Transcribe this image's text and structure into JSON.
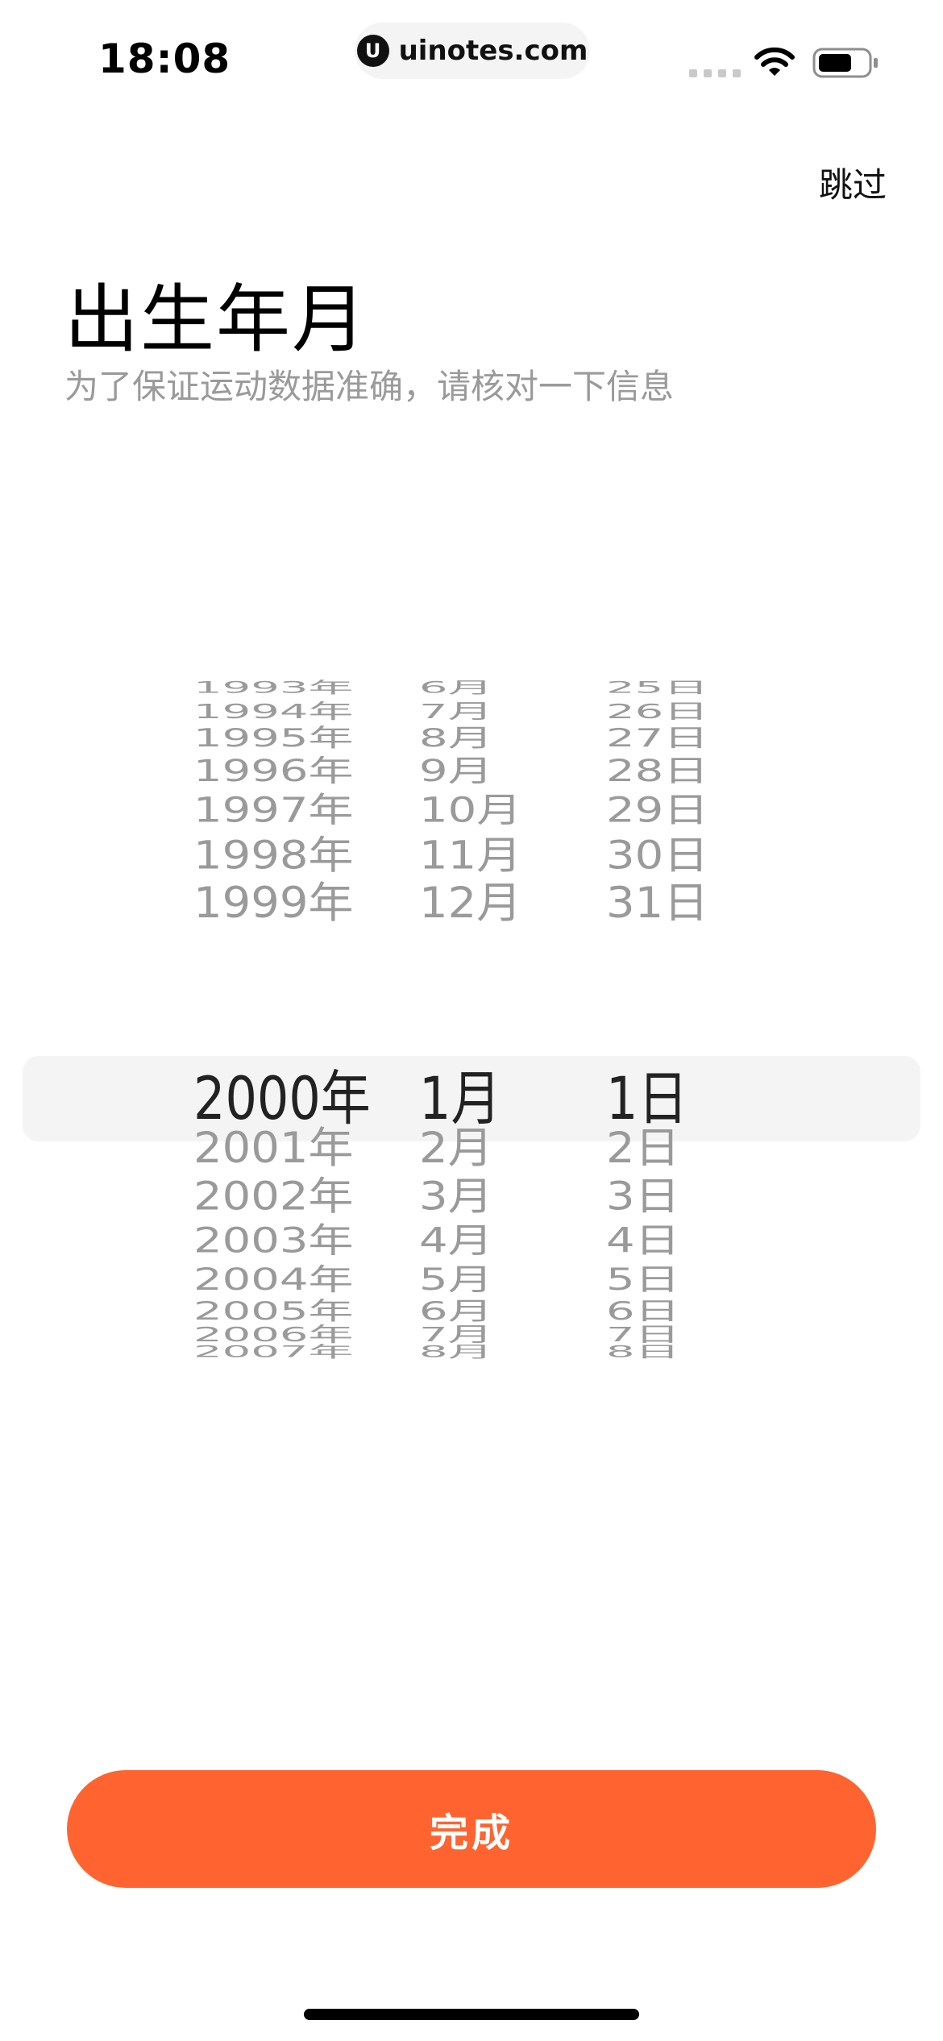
{
  "status_bar": {
    "time": "18:08",
    "url": "uinotes.com",
    "url_logo": "U"
  },
  "header": {
    "skip_label": "跳过",
    "title": "出生年月",
    "subtitle": "为了保证运动数据准确，请核对一下信息"
  },
  "picker": {
    "selected": {
      "year": "2000年",
      "month": "1月",
      "day": "1日"
    },
    "rows": [
      {
        "year": "1993年",
        "month": "6月",
        "day": "25日"
      },
      {
        "year": "1994年",
        "month": "7月",
        "day": "26日"
      },
      {
        "year": "1995年",
        "month": "8月",
        "day": "27日"
      },
      {
        "year": "1996年",
        "month": "9月",
        "day": "28日"
      },
      {
        "year": "1997年",
        "month": "10月",
        "day": "29日"
      },
      {
        "year": "1998年",
        "month": "11月",
        "day": "30日"
      },
      {
        "year": "1999年",
        "month": "12月",
        "day": "31日"
      },
      {
        "year": "2000年",
        "month": "1月",
        "day": "1日"
      },
      {
        "year": "2001年",
        "month": "2月",
        "day": "2日"
      },
      {
        "year": "2002年",
        "month": "3月",
        "day": "3日"
      },
      {
        "year": "2003年",
        "month": "4月",
        "day": "4日"
      },
      {
        "year": "2004年",
        "month": "5月",
        "day": "5日"
      },
      {
        "year": "2005年",
        "month": "6月",
        "day": "6日"
      },
      {
        "year": "2006年",
        "month": "7月",
        "day": "7日"
      },
      {
        "year": "2007年",
        "month": "8月",
        "day": "8日"
      }
    ]
  },
  "actions": {
    "done_label": "完成"
  },
  "colors": {
    "accent": "#ff6430",
    "selected_text": "#222222",
    "unselected_text": "#9a9a9a",
    "highlight_band": "#f4f4f4"
  },
  "icons": {
    "wifi": "wifi-icon",
    "battery": "battery-icon",
    "signal": "cellular-signal-icon"
  }
}
